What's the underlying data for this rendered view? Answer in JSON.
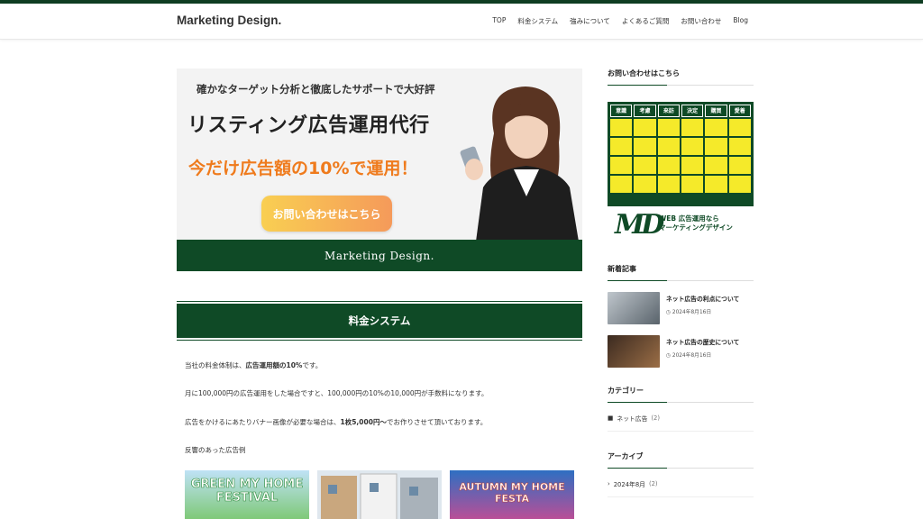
{
  "site": {
    "logo": "Marketing Design."
  },
  "nav": [
    "TOP",
    "料金システム",
    "強みについて",
    "よくあるご質問",
    "お問い合わせ",
    "Blog"
  ],
  "hero": {
    "tagline": "確かなターゲット分析と徹底したサポートで大好評",
    "title": "リスティング広告運用代行",
    "offer": "今だけ広告額の10%で運用！",
    "cta": "お問い合わせはこちら",
    "band": "Marketing Design."
  },
  "section": {
    "title": "料金システム"
  },
  "body": {
    "p1_pre": "当社の料金体制は、",
    "p1_bold": "広告運用額の10%",
    "p1_post": "です。",
    "p2": "月に100,000円の広告運用をした場合ですと、100,000円の10%の10,000円が手数料になります。",
    "p3_pre": "広告をかけるにあたりバナー画像が必要な場合は、",
    "p3_bold": "1枚5,000円〜",
    "p3_post": "でお作りさせて頂いております。",
    "p4": "反響のあった広告例"
  },
  "examples": [
    {
      "text": "GREEN MY HOME FESTIVAL"
    },
    {
      "text": ""
    },
    {
      "text": "AUTUMN MY HOME FESTA"
    }
  ],
  "sidebar": {
    "contact_title": "お問い合わせはこちら",
    "grid_headers": [
      "意識",
      "考慮",
      "来訪",
      "決定",
      "購買",
      "愛着"
    ],
    "md_logo": "MD",
    "md_line1": "WEB 広告運用なら",
    "md_line2": "マーケティングデザイン",
    "new_title": "新着記事",
    "posts": [
      {
        "title": "ネット広告の利点について",
        "date": "2024年8月16日"
      },
      {
        "title": "ネット広告の歴史について",
        "date": "2024年8月16日"
      }
    ],
    "cat_title": "カテゴリー",
    "categories": [
      {
        "label": "ネット広告",
        "count": "(2)"
      }
    ],
    "archive_title": "アーカイブ",
    "archives": [
      {
        "label": "2024年8月",
        "count": "(2)"
      }
    ]
  },
  "colors": {
    "brand": "#0f4a26",
    "accent": "#ef7b1d"
  }
}
